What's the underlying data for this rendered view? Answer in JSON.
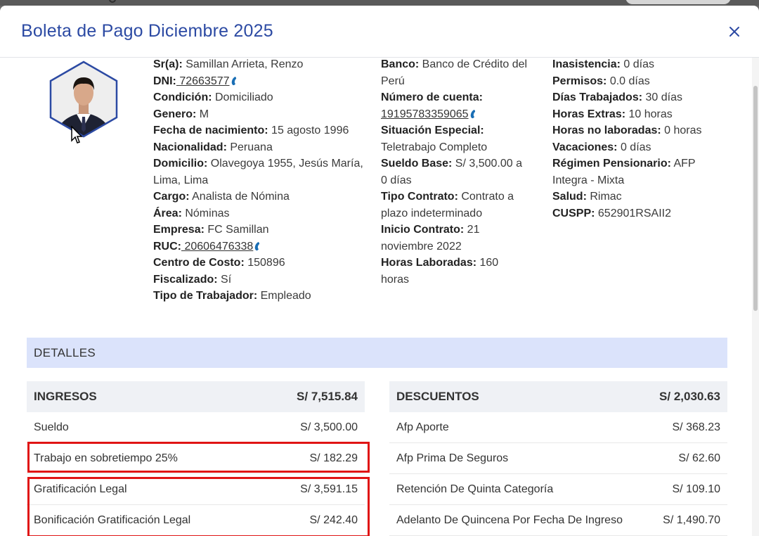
{
  "modal": {
    "title": "Boleta de Pago Diciembre 2025"
  },
  "icons": {
    "close": "close-icon",
    "phone": "phone-icon",
    "avatar": "employee-photo-avatar"
  },
  "colors": {
    "title": "#2c4aa3",
    "section_bg": "#dbe3fb",
    "panel_header_bg": "#eff1f5",
    "highlight": "#e01515"
  },
  "employee": {
    "sr_label": "Sr(a):",
    "sr": " Samillan Arrieta, Renzo",
    "dni_label": "DNI:",
    "dni": " 72663577",
    "condicion_label": "Condición:",
    "condicion": " Domiciliado",
    "genero_label": "Genero:",
    "genero": " M",
    "nacimiento_label": "Fecha de nacimiento:",
    "nacimiento": " 15 agosto 1996",
    "nacionalidad_label": "Nacionalidad:",
    "nacionalidad": " Peruana",
    "domicilio_label": "Domicilio:",
    "domicilio": " Olavegoya 1955, Jesús María, Lima, Lima",
    "cargo_label": "Cargo:",
    "cargo": " Analista de Nómina",
    "area_label": "Área:",
    "area": " Nóminas",
    "empresa_label": "Empresa:",
    "empresa": " FC Samillan",
    "ruc_label": "RUC:",
    "ruc": " 20606476338",
    "centro_label": "Centro de Costo:",
    "centro": " 150896",
    "fiscalizado_label": "Fiscalizado:",
    "fiscalizado": " Sí",
    "tipo_trabajador_label": "Tipo de Trabajador:",
    "tipo_trabajador": " Empleado"
  },
  "contract": {
    "banco_label": "Banco:",
    "banco": " Banco de Crédito del Perú",
    "cuenta_label": "Número de cuenta:",
    "cuenta": "19195783359065",
    "situacion_label": "Situación Especial:",
    "situacion": "Teletrabajo Completo",
    "sueldo_label": "Sueldo Base:",
    "sueldo": " S/ 3,500.00 a 0 días",
    "tipo_contrato_label": "Tipo Contrato:",
    "tipo_contrato": " Contrato a plazo indeterminado",
    "inicio_label": "Inicio Contrato:",
    "inicio": " 21 noviembre 2022",
    "horas_lab_label": "Horas Laboradas:",
    "horas_lab": " 160 horas"
  },
  "attendance": {
    "inasistencia_label": "Inasistencia:",
    "inasistencia": " 0 días",
    "permisos_label": "Permisos:",
    "permisos": " 0.0 días",
    "dias_label": "Días Trabajados:",
    "dias": " 30 días",
    "extras_label": "Horas Extras:",
    "extras": " 10 horas",
    "no_lab_label": "Horas no laboradas:",
    "no_lab": " 0 horas",
    "vacaciones_label": "Vacaciones:",
    "vacaciones": " 0 días",
    "regimen_label": "Régimen Pensionario:",
    "regimen": " AFP Integra - Mixta",
    "salud_label": "Salud:",
    "salud": " Rimac",
    "cuspp_label": "CUSPP:",
    "cuspp": " 652901RSAII2"
  },
  "detalles": {
    "label": "DETALLES"
  },
  "ingresos": {
    "label": "INGRESOS",
    "total": "S/ 7,515.84",
    "items": [
      {
        "label": "Sueldo",
        "value": "S/ 3,500.00"
      },
      {
        "label": "Trabajo en sobretiempo 25%",
        "value": "S/ 182.29"
      },
      {
        "label": "Gratificación Legal",
        "value": "S/ 3,591.15"
      },
      {
        "label": "Bonificación Gratificación Legal",
        "value": "S/ 242.40"
      }
    ]
  },
  "descuentos": {
    "label": "DESCUENTOS",
    "total": "S/ 2,030.63",
    "items": [
      {
        "label": "Afp Aporte",
        "value": "S/ 368.23"
      },
      {
        "label": "Afp Prima De Seguros",
        "value": "S/ 62.60"
      },
      {
        "label": "Retención De Quinta Categoría",
        "value": "S/ 109.10"
      },
      {
        "label": "Adelanto De Quincena Por Fecha De Ingreso",
        "value": "S/ 1,490.70"
      }
    ]
  }
}
